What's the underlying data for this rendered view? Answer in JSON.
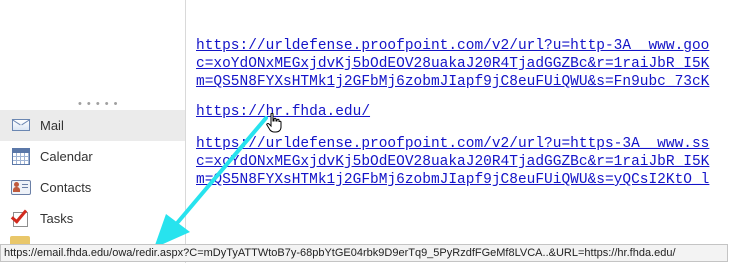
{
  "nav": {
    "items": [
      {
        "label": "Mail",
        "icon": "mail-icon",
        "active": true
      },
      {
        "label": "Calendar",
        "icon": "calendar-icon",
        "active": false
      },
      {
        "label": "Contacts",
        "icon": "contacts-icon",
        "active": false
      },
      {
        "label": "Tasks",
        "icon": "tasks-icon",
        "active": false
      }
    ]
  },
  "message": {
    "links": [
      {
        "lines": [
          "https://urldefense.proofpoint.com/v2/url?u=http-3A__www.goo",
          "c=xoYdONxMEGxjdvKj5bOdEOV28uakaJ20R4TjadGGZBc&r=1raiJbR_I5K",
          "m=QS5N8FYXsHTMk1j2GFbMj6zobmJIapf9jC8euFUiQWU&s=Fn9ubc_73cK"
        ]
      },
      {
        "lines": [
          "https://hr.fhda.edu/"
        ]
      },
      {
        "lines": [
          "https://urldefense.proofpoint.com/v2/url?u=https-3A__www.ss",
          "c=xoYdONxMEGxjdvKj5bOdEOV28uakaJ20R4TjadGGZBc&r=1raiJbR_I5K",
          "m=QS5N8FYXsHTMk1j2GFbMj6zobmJIapf9jC8euFUiQWU&s=yQCsI2KtO_l"
        ]
      }
    ]
  },
  "status_bar": {
    "url": "https://email.fhda.edu/owa/redir.aspx?C=mDyTyATTWtoB7y-68pbYtGE04rbk9D9erTq9_5PyRzdfFGeMf8LVCA..&URL=https://hr.fhda.edu/"
  },
  "colors": {
    "link": "#1414c8",
    "annotation_arrow": "#27e3ee"
  }
}
